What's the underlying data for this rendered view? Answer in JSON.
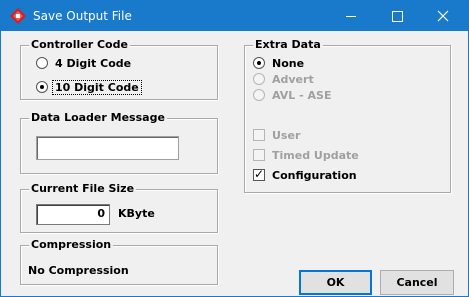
{
  "window": {
    "title": "Save Output File"
  },
  "controller_code": {
    "title": "Controller Code",
    "options": [
      {
        "label": "4 Digit Code",
        "selected": false
      },
      {
        "label": "10 Digit Code",
        "selected": true
      }
    ]
  },
  "data_loader": {
    "title": "Data Loader Message",
    "value": ""
  },
  "file_size": {
    "title": "Current File Size",
    "value": "0",
    "unit": "KByte"
  },
  "compression": {
    "title": "Compression",
    "value": "No Compression"
  },
  "extra_data": {
    "title": "Extra Data",
    "radios": [
      {
        "label": "None",
        "selected": true,
        "enabled": true
      },
      {
        "label": "Advert",
        "selected": false,
        "enabled": false
      },
      {
        "label": "AVL - ASE",
        "selected": false,
        "enabled": false
      }
    ],
    "checks": [
      {
        "label": "User",
        "checked": false,
        "enabled": false
      },
      {
        "label": "Timed Update",
        "checked": false,
        "enabled": false
      },
      {
        "label": "Configuration",
        "checked": true,
        "enabled": true
      }
    ]
  },
  "buttons": {
    "ok": "OK",
    "cancel": "Cancel"
  },
  "icons": {
    "app": "app-diamond-icon",
    "minimize": "minimize-icon",
    "maximize": "maximize-icon",
    "close": "close-icon"
  },
  "colors": {
    "titlebar": "#1979ca",
    "window_bg": "#f0f0f0"
  }
}
